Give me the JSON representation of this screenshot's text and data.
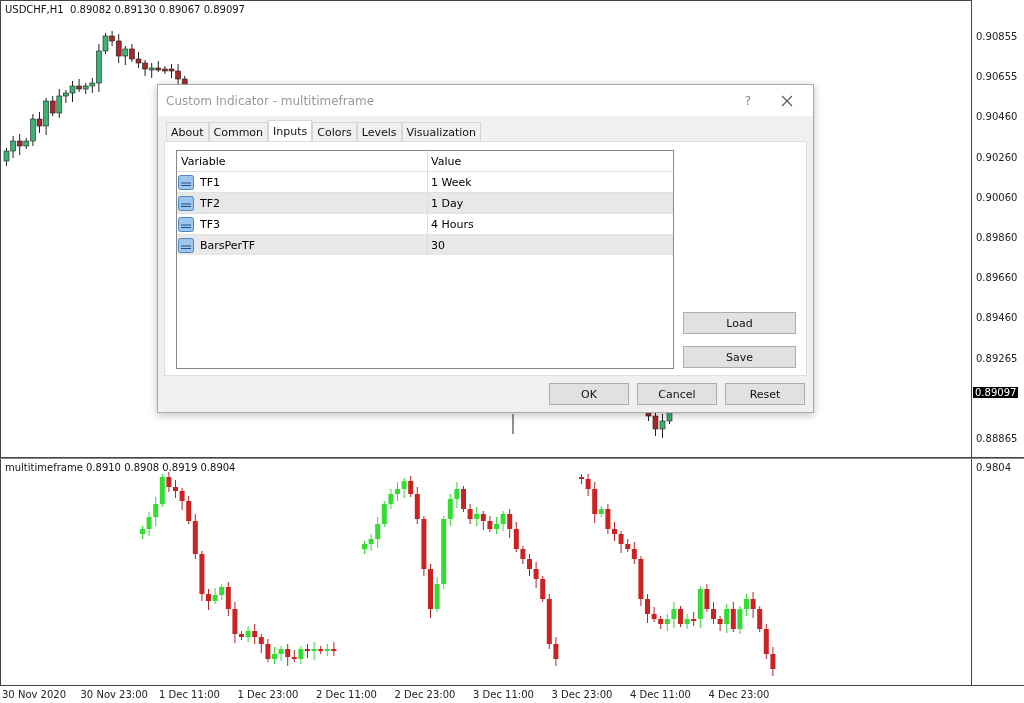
{
  "main_chart": {
    "header": "USDCHF,H1  0.89082 0.89130 0.89067 0.89097",
    "price_axis": [
      "0.90855",
      "0.90655",
      "0.90460",
      "0.90260",
      "0.90060",
      "0.89860",
      "0.89660",
      "0.89460",
      "0.89265",
      "0.88865"
    ],
    "current_price": "0.89097"
  },
  "indicator_window": {
    "header": "multitimeframe 0.8910 0.8908 0.8919 0.8904",
    "price_axis": [
      "0.9804"
    ]
  },
  "time_axis": [
    "30 Nov 2020",
    "30 Nov 23:00",
    "1 Dec 11:00",
    "1 Dec 23:00",
    "2 Dec 11:00",
    "2 Dec 23:00",
    "3 Dec 11:00",
    "3 Dec 23:00",
    "4 Dec 11:00",
    "4 Dec 23:00"
  ],
  "dialog": {
    "title": "Custom Indicator - multitimeframe",
    "help": "?",
    "tabs": [
      {
        "label": "About",
        "selected": false
      },
      {
        "label": "Common",
        "selected": false
      },
      {
        "label": "Inputs",
        "selected": true
      },
      {
        "label": "Colors",
        "selected": false
      },
      {
        "label": "Levels",
        "selected": false
      },
      {
        "label": "Visualization",
        "selected": false
      }
    ],
    "table": {
      "columns": [
        "Variable",
        "Value"
      ],
      "rows": [
        {
          "variable": "TF1",
          "value": "1 Week"
        },
        {
          "variable": "TF2",
          "value": "1 Day"
        },
        {
          "variable": "TF3",
          "value": "4 Hours"
        },
        {
          "variable": "BarsPerTF",
          "value": "30"
        }
      ]
    },
    "side_buttons": [
      "Load",
      "Save"
    ],
    "buttons": [
      "OK",
      "Cancel",
      "Reset"
    ]
  }
}
